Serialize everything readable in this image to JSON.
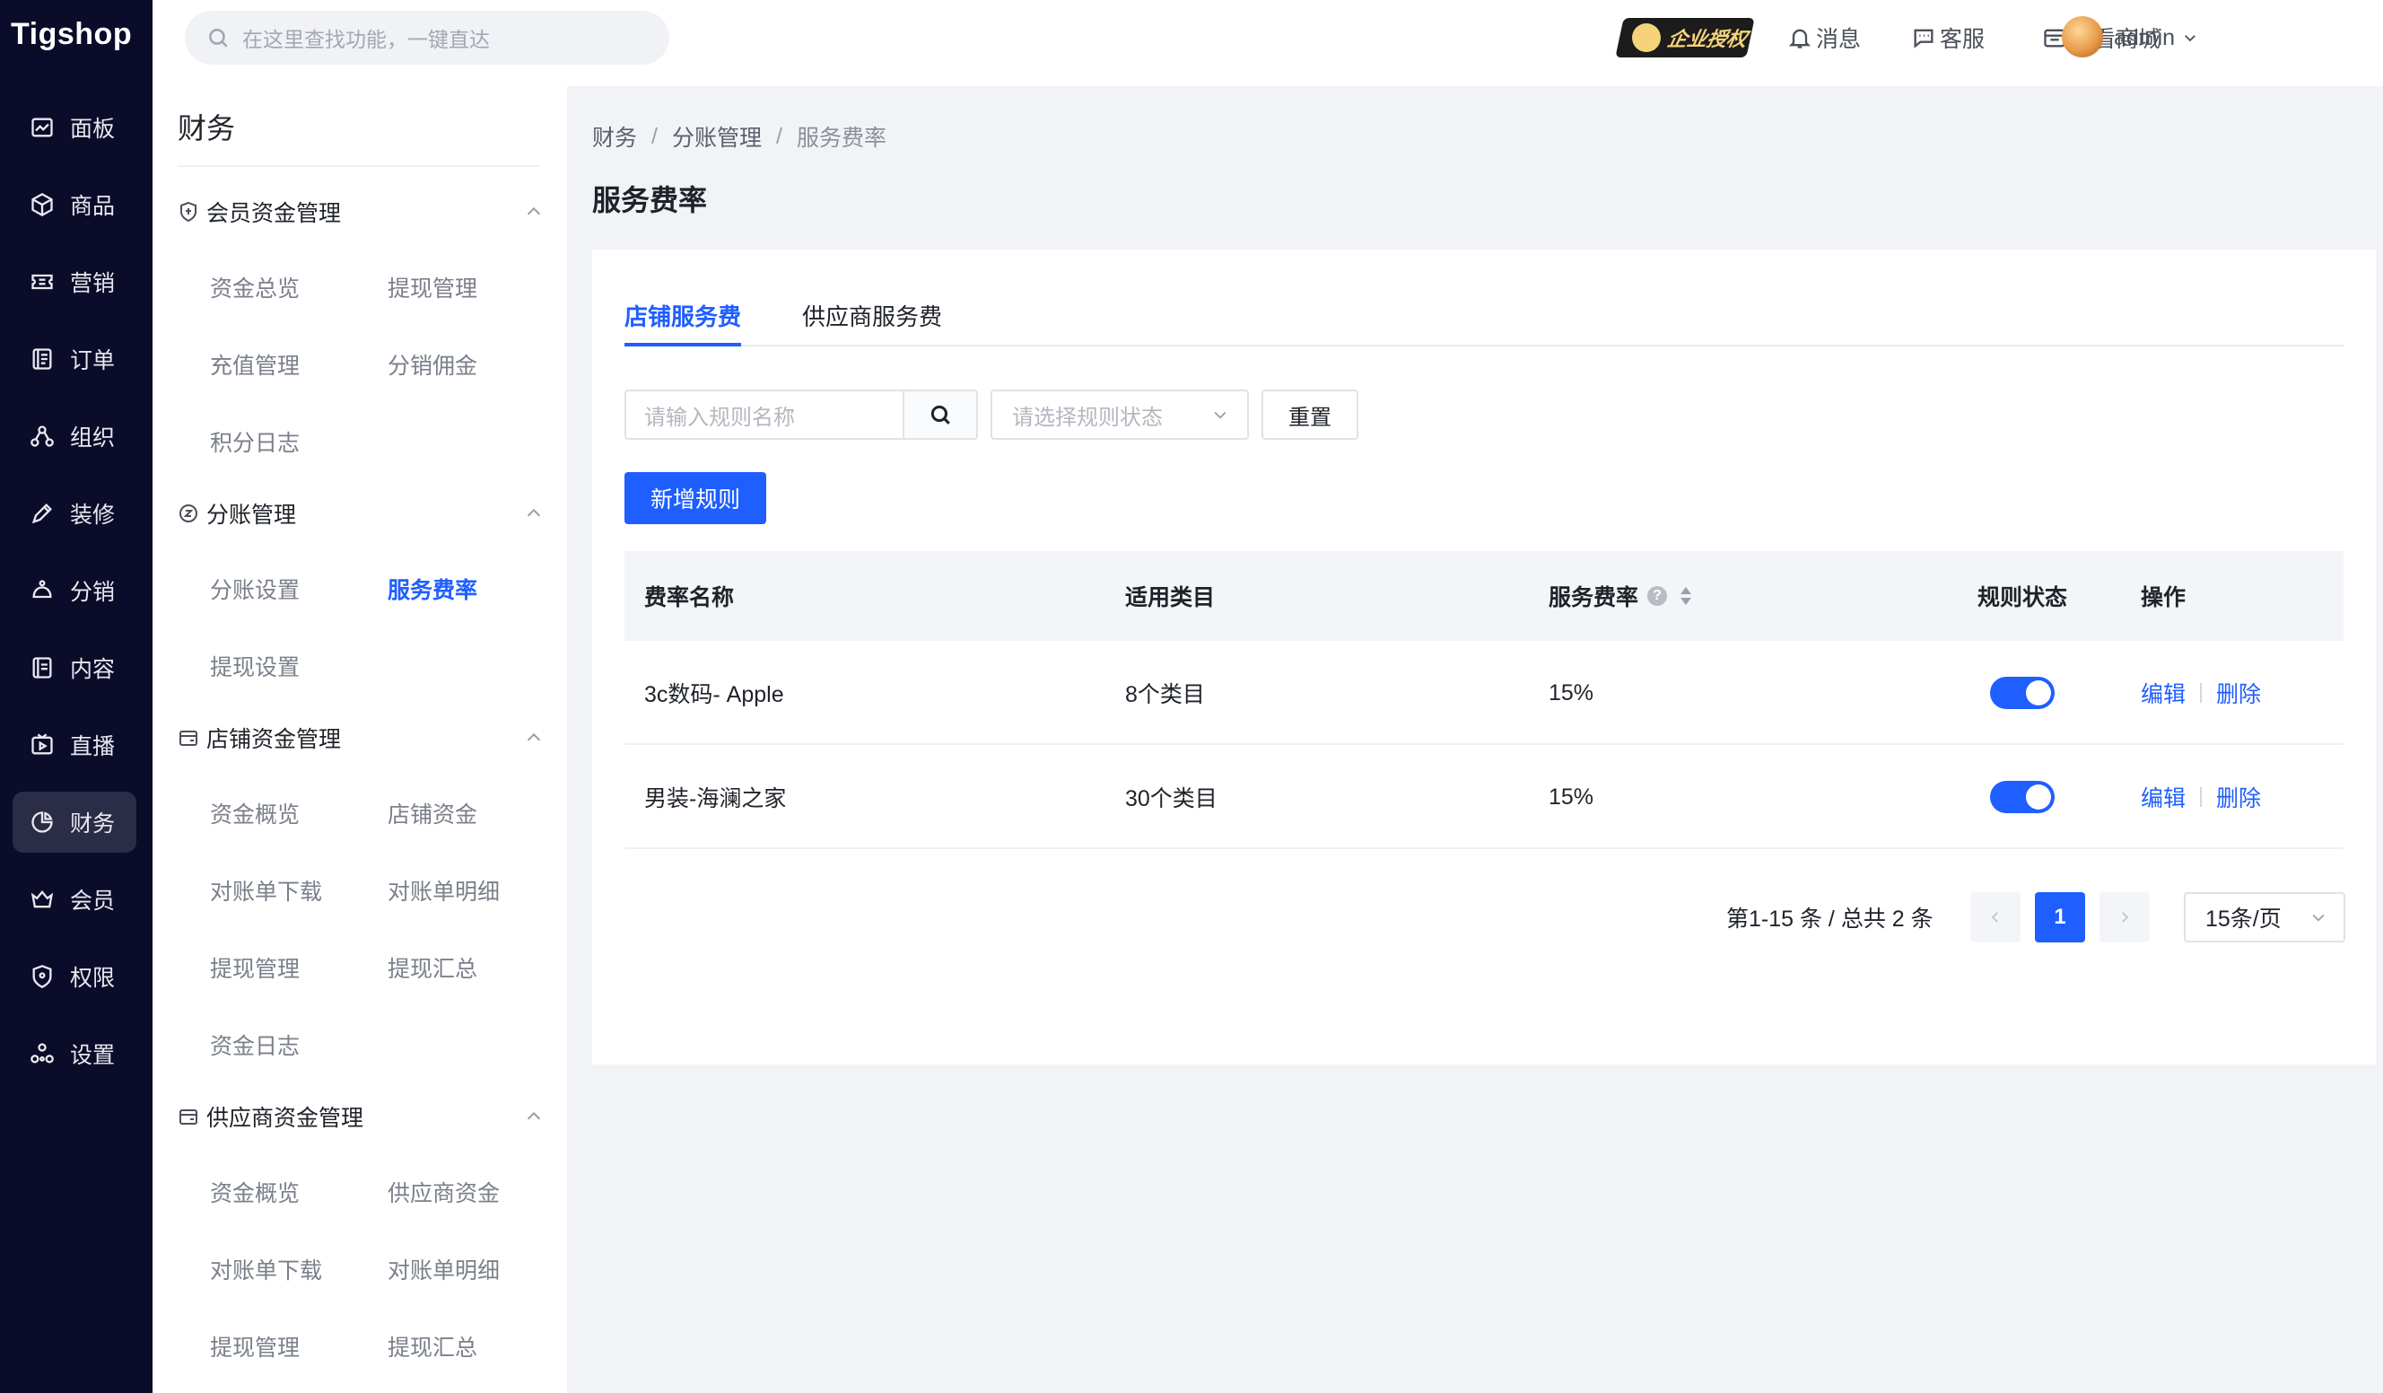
{
  "app": {
    "logo": "Tigshop"
  },
  "header": {
    "search_placeholder": "在这里查找功能，一键直达",
    "license_badge": "企业授权",
    "links": {
      "messages": "消息",
      "service": "客服",
      "view_store": "查看商城"
    },
    "user": "admin"
  },
  "rail": {
    "items": [
      {
        "label": "面板",
        "icon": "dashboard-icon"
      },
      {
        "label": "商品",
        "icon": "box-icon"
      },
      {
        "label": "营销",
        "icon": "ticket-icon"
      },
      {
        "label": "订单",
        "icon": "order-icon"
      },
      {
        "label": "组织",
        "icon": "org-icon"
      },
      {
        "label": "装修",
        "icon": "paint-icon"
      },
      {
        "label": "分销",
        "icon": "distribution-icon"
      },
      {
        "label": "内容",
        "icon": "content-icon"
      },
      {
        "label": "直播",
        "icon": "live-icon"
      },
      {
        "label": "财务",
        "icon": "finance-icon",
        "active": true
      },
      {
        "label": "会员",
        "icon": "member-icon"
      },
      {
        "label": "权限",
        "icon": "shield-icon"
      },
      {
        "label": "设置",
        "icon": "settings-icon"
      }
    ]
  },
  "submenu": {
    "title": "财务",
    "groups": [
      {
        "title": "会员资金管理",
        "items": [
          "资金总览",
          "提现管理",
          "充值管理",
          "分销佣金",
          "积分日志"
        ]
      },
      {
        "title": "分账管理",
        "items": [
          "分账设置",
          "服务费率",
          "提现设置"
        ]
      },
      {
        "title": "店铺资金管理",
        "items": [
          "资金概览",
          "店铺资金",
          "对账单下载",
          "对账单明细",
          "提现管理",
          "提现汇总",
          "资金日志"
        ]
      },
      {
        "title": "供应商资金管理",
        "items": [
          "资金概览",
          "供应商资金",
          "对账单下载",
          "对账单明细",
          "提现管理",
          "提现汇总"
        ]
      }
    ],
    "active_item": "服务费率"
  },
  "breadcrumb": [
    "财务",
    "分账管理",
    "服务费率"
  ],
  "page_title": "服务费率",
  "tabs": [
    {
      "label": "店铺服务费",
      "active": true
    },
    {
      "label": "供应商服务费",
      "active": false
    }
  ],
  "filters": {
    "name_placeholder": "请输入规则名称",
    "status_placeholder": "请选择规则状态",
    "reset_label": "重置"
  },
  "add_button": "新增规则",
  "table": {
    "columns": [
      "费率名称",
      "适用类目",
      "服务费率",
      "规则状态",
      "操作"
    ],
    "rows": [
      {
        "name": "3c数码- Apple",
        "category": "8个类目",
        "rate": "15%",
        "enabled": true
      },
      {
        "name": "男装-海澜之家",
        "category": "30个类目",
        "rate": "15%",
        "enabled": true
      }
    ],
    "actions": {
      "edit": "编辑",
      "delete": "删除"
    }
  },
  "pagination": {
    "summary": "第1-15 条 / 总共 2 条",
    "current_page": "1",
    "page_size": "15条/页"
  },
  "colors": {
    "primary": "#1f5eff",
    "rail_bg": "#0b0b2a"
  }
}
